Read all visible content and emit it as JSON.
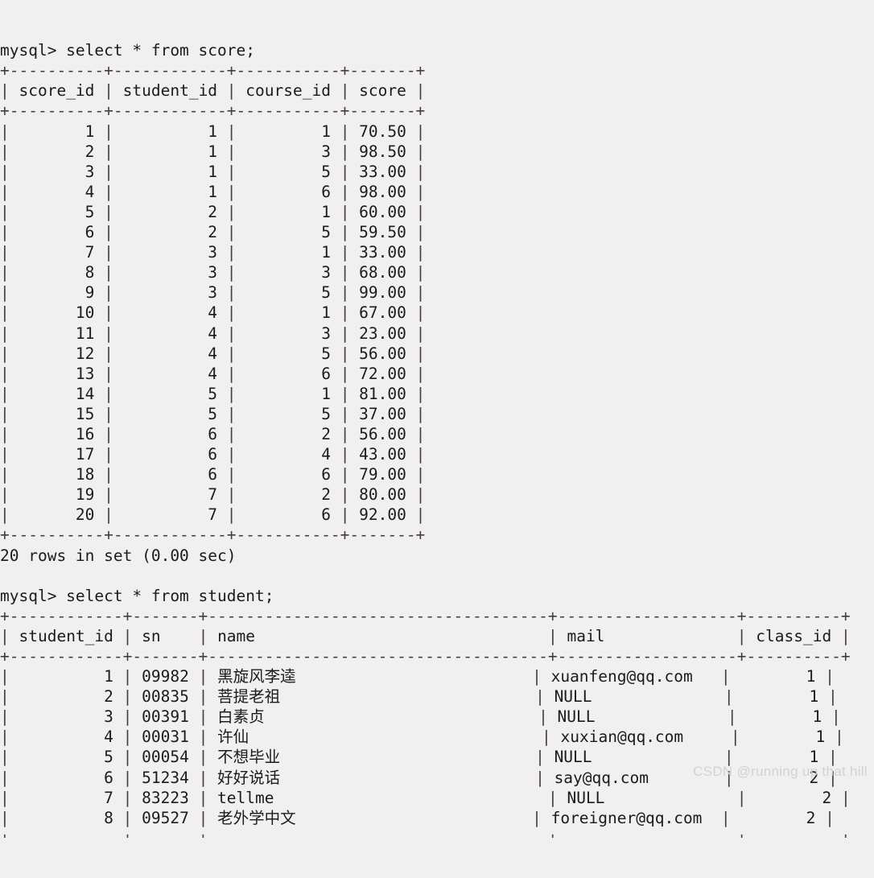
{
  "terminal": {
    "prompt": "mysql>",
    "background_color": "#f0f0f0",
    "text_color": "#1b1b1b",
    "rule_color": "#4a3b3b"
  },
  "watermark": {
    "text": "CSDN @running up that hill",
    "color": "#d2d2d2"
  },
  "blocks": [
    {
      "command": "mysql> select * from score;",
      "table": {
        "columns": [
          {
            "name": "score_id",
            "width": 10,
            "align": "right"
          },
          {
            "name": "student_id",
            "width": 12,
            "align": "right"
          },
          {
            "name": "course_id",
            "width": 11,
            "align": "right"
          },
          {
            "name": "score",
            "width": 7,
            "align": "right"
          }
        ],
        "rows": [
          [
            "1",
            "1",
            "1",
            "70.50"
          ],
          [
            "2",
            "1",
            "3",
            "98.50"
          ],
          [
            "3",
            "1",
            "5",
            "33.00"
          ],
          [
            "4",
            "1",
            "6",
            "98.00"
          ],
          [
            "5",
            "2",
            "1",
            "60.00"
          ],
          [
            "6",
            "2",
            "5",
            "59.50"
          ],
          [
            "7",
            "3",
            "1",
            "33.00"
          ],
          [
            "8",
            "3",
            "3",
            "68.00"
          ],
          [
            "9",
            "3",
            "5",
            "99.00"
          ],
          [
            "10",
            "4",
            "1",
            "67.00"
          ],
          [
            "11",
            "4",
            "3",
            "23.00"
          ],
          [
            "12",
            "4",
            "5",
            "56.00"
          ],
          [
            "13",
            "4",
            "6",
            "72.00"
          ],
          [
            "14",
            "5",
            "1",
            "81.00"
          ],
          [
            "15",
            "5",
            "5",
            "37.00"
          ],
          [
            "16",
            "6",
            "2",
            "56.00"
          ],
          [
            "17",
            "6",
            "4",
            "43.00"
          ],
          [
            "18",
            "6",
            "6",
            "79.00"
          ],
          [
            "19",
            "7",
            "2",
            "80.00"
          ],
          [
            "20",
            "7",
            "6",
            "92.00"
          ]
        ]
      },
      "status": "20 rows in set (0.00 sec)"
    },
    {
      "command": "mysql> select * from student;",
      "table": {
        "columns": [
          {
            "name": "student_id",
            "width": 12,
            "align": "right"
          },
          {
            "name": "sn",
            "width": 7,
            "align": "left"
          },
          {
            "name": "name",
            "width": 36,
            "align": "left"
          },
          {
            "name": "mail",
            "width": 19,
            "align": "left"
          },
          {
            "name": "class_id",
            "width": 10,
            "align": "right"
          }
        ],
        "rows": [
          [
            "1",
            "09982",
            "黑旋风李逵",
            "xuanfeng@qq.com",
            "1"
          ],
          [
            "2",
            "00835",
            "菩提老祖",
            "NULL",
            "1"
          ],
          [
            "3",
            "00391",
            "白素贞",
            "NULL",
            "1"
          ],
          [
            "4",
            "00031",
            "许仙",
            "xuxian@qq.com",
            "1"
          ],
          [
            "5",
            "00054",
            "不想毕业",
            "NULL",
            "1"
          ],
          [
            "6",
            "51234",
            "好好说话",
            "say@qq.com",
            "2"
          ],
          [
            "7",
            "83223",
            "tellme",
            "NULL",
            "2"
          ],
          [
            "8",
            "09527",
            "老外学中文",
            "foreigner@qq.com",
            "2"
          ]
        ]
      },
      "status": null,
      "truncated": true
    }
  ]
}
